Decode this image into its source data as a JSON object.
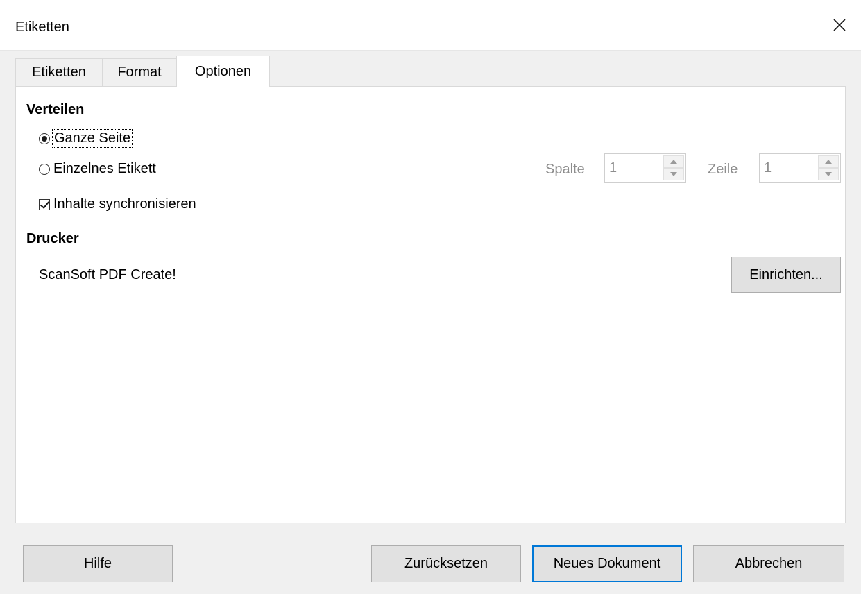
{
  "window": {
    "title": "Etiketten"
  },
  "tabs": [
    {
      "label": "Etiketten"
    },
    {
      "label": "Format"
    },
    {
      "label": "Optionen",
      "active": true
    }
  ],
  "distribute": {
    "heading": "Verteilen",
    "option_whole_page": "Ganze Seite",
    "option_single_label": "Einzelnes Etikett",
    "selected": "Ganze Seite",
    "sync_label": "Inhalte synchronisieren",
    "sync_checked": true,
    "column_label": "Spalte",
    "column_value": "1",
    "row_label": "Zeile",
    "row_value": "1"
  },
  "printer": {
    "heading": "Drucker",
    "name": "ScanSoft PDF Create!",
    "setup_label": "Einrichten..."
  },
  "footer": {
    "help_label": "Hilfe",
    "reset_label": "Zurücksetzen",
    "new_document_label": "Neues Dokument",
    "cancel_label": "Abbrechen"
  },
  "colors": {
    "focus_border": "#0078d7",
    "disabled_text": "#8d8d8d"
  },
  "icons": {
    "close": "close-icon",
    "spin_up": "chevron-up-icon",
    "spin_down": "chevron-down-icon"
  }
}
